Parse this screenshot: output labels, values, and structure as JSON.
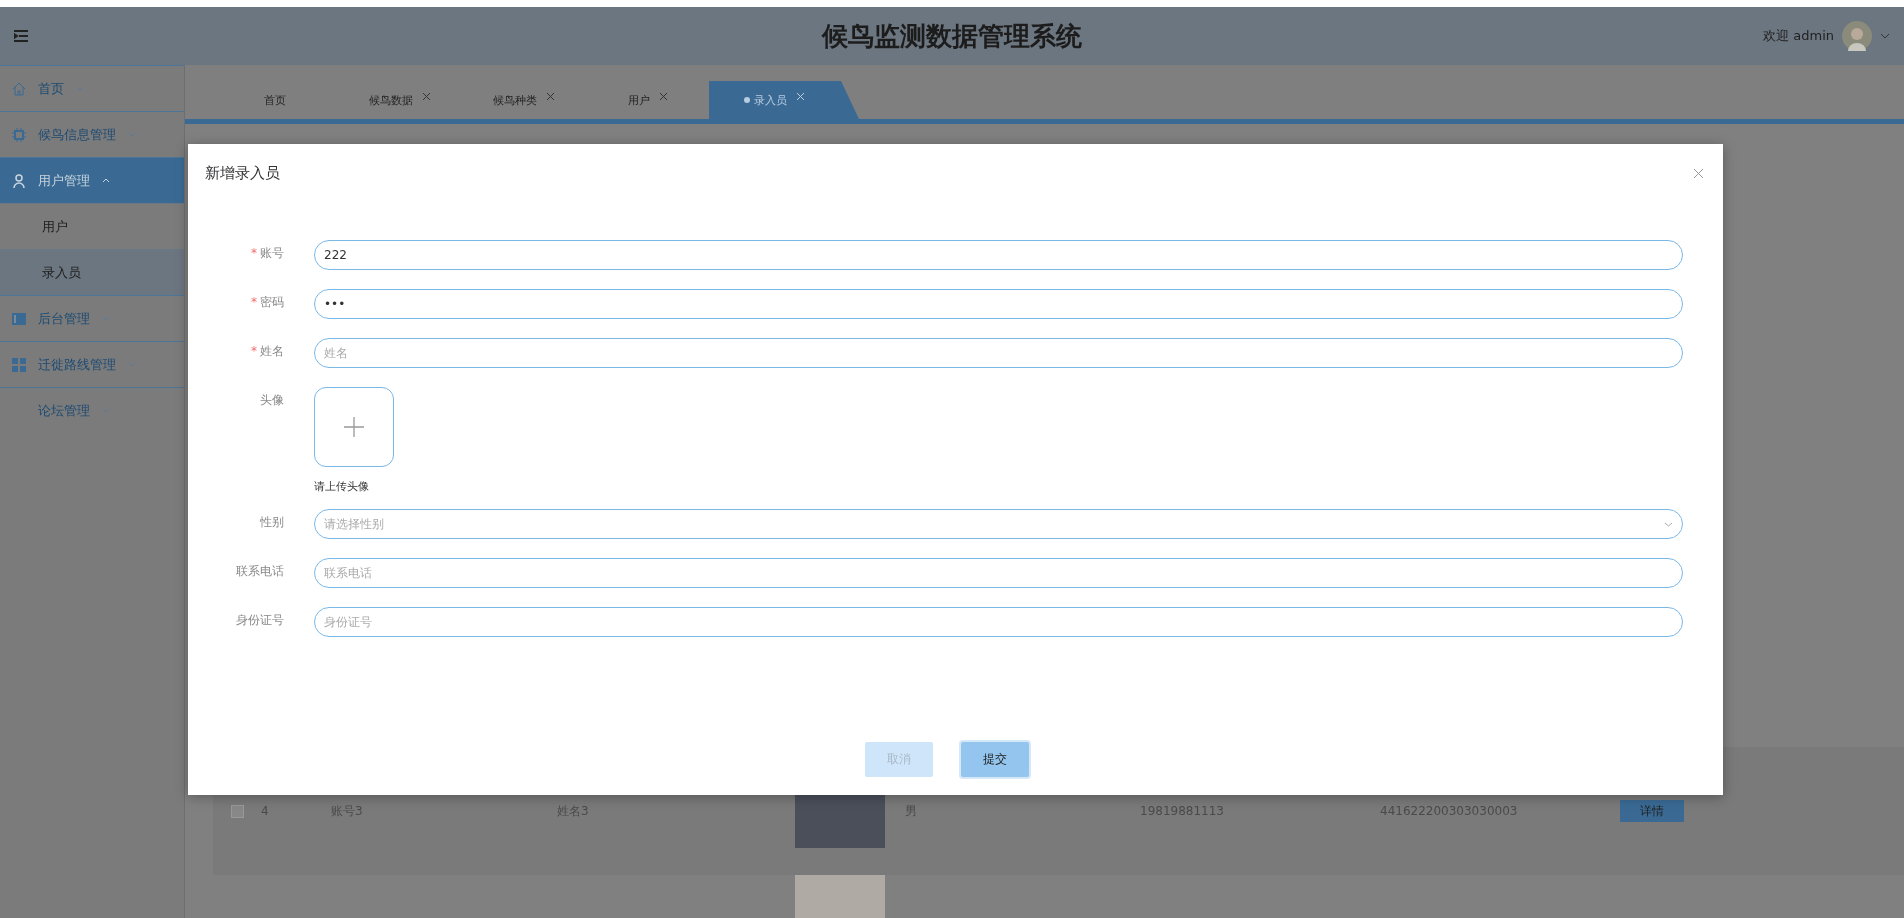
{
  "header": {
    "title": "候鸟监测数据管理系统",
    "welcome": "欢迎 admin"
  },
  "sidebar": {
    "items": [
      {
        "label": "首页",
        "expanded": false,
        "selected": false
      },
      {
        "label": "候鸟信息管理",
        "expanded": false,
        "selected": false
      },
      {
        "label": "用户管理",
        "expanded": true,
        "selected": true,
        "children": [
          {
            "label": "用户",
            "selected": false
          },
          {
            "label": "录入员",
            "selected": true
          }
        ]
      },
      {
        "label": "后台管理",
        "expanded": false,
        "selected": false
      },
      {
        "label": "迁徙路线管理",
        "expanded": false,
        "selected": false
      },
      {
        "label": "论坛管理",
        "expanded": false,
        "selected": false
      }
    ]
  },
  "tabs": [
    {
      "label": "首页",
      "closable": false,
      "selected": false
    },
    {
      "label": "候鸟数据",
      "closable": true,
      "selected": false
    },
    {
      "label": "候鸟种类",
      "closable": true,
      "selected": false
    },
    {
      "label": "用户",
      "closable": true,
      "selected": false
    },
    {
      "label": "录入员",
      "closable": true,
      "selected": true
    }
  ],
  "table": {
    "rows": [
      {
        "checked": false,
        "index": "4",
        "account": "账号3",
        "name": "姓名3",
        "photo": true,
        "gender": "男",
        "phone": "19819881113",
        "id_number": "441622200303030003",
        "action": "详情"
      },
      {
        "photo": true
      }
    ]
  },
  "dialog": {
    "title": "新增录入员",
    "fields": [
      {
        "kind": "text",
        "required_mark": "*",
        "label": "账号",
        "value": "222"
      },
      {
        "kind": "password",
        "required_mark": "*",
        "label": "密码",
        "value": "•••"
      },
      {
        "kind": "text",
        "required_mark": "*",
        "label": "姓名",
        "placeholder": "姓名"
      },
      {
        "kind": "upload",
        "label": "头像",
        "hint": "请上传头像"
      },
      {
        "kind": "select",
        "label": "性别",
        "placeholder": "请选择性别"
      },
      {
        "kind": "text",
        "label": "联系电话",
        "placeholder": "联系电话"
      },
      {
        "kind": "text",
        "label": "身份证号",
        "placeholder": "身份证号"
      }
    ],
    "buttons": [
      {
        "label": "取消",
        "kind": "cancel"
      },
      {
        "label": "提交",
        "kind": "submit"
      }
    ]
  }
}
